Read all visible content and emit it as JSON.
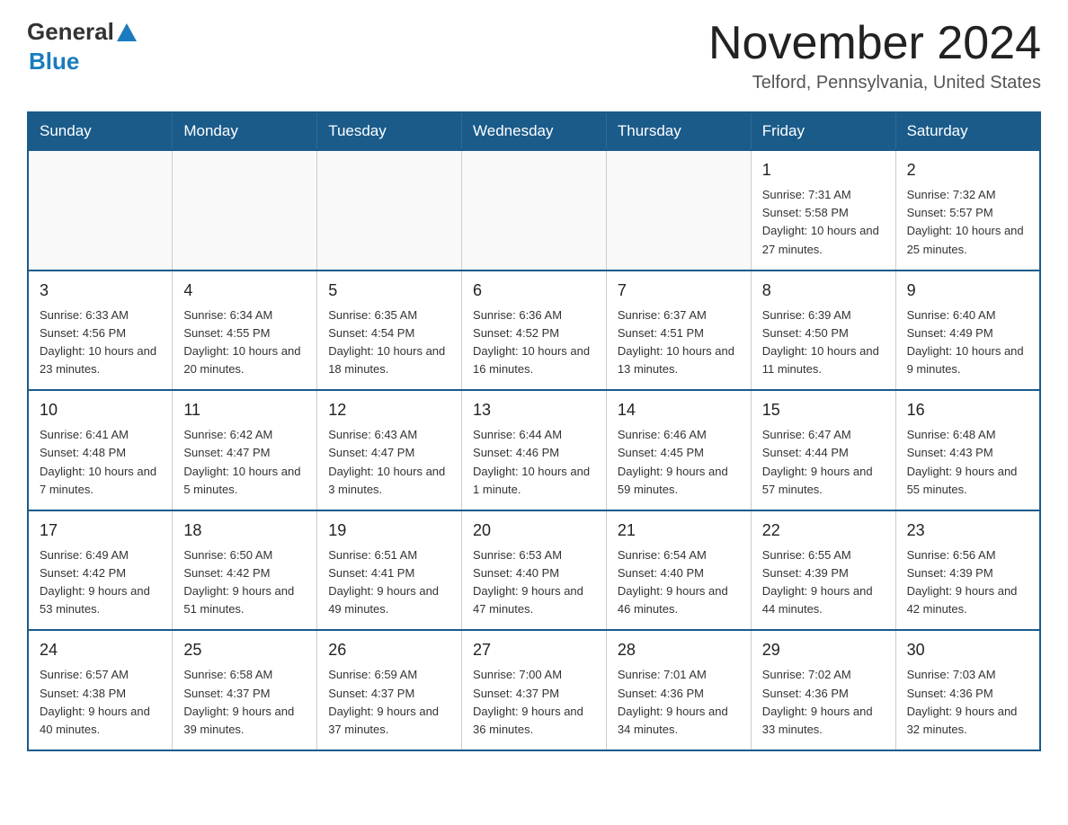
{
  "header": {
    "logo_general": "General",
    "logo_blue": "Blue",
    "month_title": "November 2024",
    "location": "Telford, Pennsylvania, United States"
  },
  "weekdays": [
    "Sunday",
    "Monday",
    "Tuesday",
    "Wednesday",
    "Thursday",
    "Friday",
    "Saturday"
  ],
  "weeks": [
    [
      {
        "day": "",
        "info": ""
      },
      {
        "day": "",
        "info": ""
      },
      {
        "day": "",
        "info": ""
      },
      {
        "day": "",
        "info": ""
      },
      {
        "day": "",
        "info": ""
      },
      {
        "day": "1",
        "info": "Sunrise: 7:31 AM\nSunset: 5:58 PM\nDaylight: 10 hours and 27 minutes."
      },
      {
        "day": "2",
        "info": "Sunrise: 7:32 AM\nSunset: 5:57 PM\nDaylight: 10 hours and 25 minutes."
      }
    ],
    [
      {
        "day": "3",
        "info": "Sunrise: 6:33 AM\nSunset: 4:56 PM\nDaylight: 10 hours and 23 minutes."
      },
      {
        "day": "4",
        "info": "Sunrise: 6:34 AM\nSunset: 4:55 PM\nDaylight: 10 hours and 20 minutes."
      },
      {
        "day": "5",
        "info": "Sunrise: 6:35 AM\nSunset: 4:54 PM\nDaylight: 10 hours and 18 minutes."
      },
      {
        "day": "6",
        "info": "Sunrise: 6:36 AM\nSunset: 4:52 PM\nDaylight: 10 hours and 16 minutes."
      },
      {
        "day": "7",
        "info": "Sunrise: 6:37 AM\nSunset: 4:51 PM\nDaylight: 10 hours and 13 minutes."
      },
      {
        "day": "8",
        "info": "Sunrise: 6:39 AM\nSunset: 4:50 PM\nDaylight: 10 hours and 11 minutes."
      },
      {
        "day": "9",
        "info": "Sunrise: 6:40 AM\nSunset: 4:49 PM\nDaylight: 10 hours and 9 minutes."
      }
    ],
    [
      {
        "day": "10",
        "info": "Sunrise: 6:41 AM\nSunset: 4:48 PM\nDaylight: 10 hours and 7 minutes."
      },
      {
        "day": "11",
        "info": "Sunrise: 6:42 AM\nSunset: 4:47 PM\nDaylight: 10 hours and 5 minutes."
      },
      {
        "day": "12",
        "info": "Sunrise: 6:43 AM\nSunset: 4:47 PM\nDaylight: 10 hours and 3 minutes."
      },
      {
        "day": "13",
        "info": "Sunrise: 6:44 AM\nSunset: 4:46 PM\nDaylight: 10 hours and 1 minute."
      },
      {
        "day": "14",
        "info": "Sunrise: 6:46 AM\nSunset: 4:45 PM\nDaylight: 9 hours and 59 minutes."
      },
      {
        "day": "15",
        "info": "Sunrise: 6:47 AM\nSunset: 4:44 PM\nDaylight: 9 hours and 57 minutes."
      },
      {
        "day": "16",
        "info": "Sunrise: 6:48 AM\nSunset: 4:43 PM\nDaylight: 9 hours and 55 minutes."
      }
    ],
    [
      {
        "day": "17",
        "info": "Sunrise: 6:49 AM\nSunset: 4:42 PM\nDaylight: 9 hours and 53 minutes."
      },
      {
        "day": "18",
        "info": "Sunrise: 6:50 AM\nSunset: 4:42 PM\nDaylight: 9 hours and 51 minutes."
      },
      {
        "day": "19",
        "info": "Sunrise: 6:51 AM\nSunset: 4:41 PM\nDaylight: 9 hours and 49 minutes."
      },
      {
        "day": "20",
        "info": "Sunrise: 6:53 AM\nSunset: 4:40 PM\nDaylight: 9 hours and 47 minutes."
      },
      {
        "day": "21",
        "info": "Sunrise: 6:54 AM\nSunset: 4:40 PM\nDaylight: 9 hours and 46 minutes."
      },
      {
        "day": "22",
        "info": "Sunrise: 6:55 AM\nSunset: 4:39 PM\nDaylight: 9 hours and 44 minutes."
      },
      {
        "day": "23",
        "info": "Sunrise: 6:56 AM\nSunset: 4:39 PM\nDaylight: 9 hours and 42 minutes."
      }
    ],
    [
      {
        "day": "24",
        "info": "Sunrise: 6:57 AM\nSunset: 4:38 PM\nDaylight: 9 hours and 40 minutes."
      },
      {
        "day": "25",
        "info": "Sunrise: 6:58 AM\nSunset: 4:37 PM\nDaylight: 9 hours and 39 minutes."
      },
      {
        "day": "26",
        "info": "Sunrise: 6:59 AM\nSunset: 4:37 PM\nDaylight: 9 hours and 37 minutes."
      },
      {
        "day": "27",
        "info": "Sunrise: 7:00 AM\nSunset: 4:37 PM\nDaylight: 9 hours and 36 minutes."
      },
      {
        "day": "28",
        "info": "Sunrise: 7:01 AM\nSunset: 4:36 PM\nDaylight: 9 hours and 34 minutes."
      },
      {
        "day": "29",
        "info": "Sunrise: 7:02 AM\nSunset: 4:36 PM\nDaylight: 9 hours and 33 minutes."
      },
      {
        "day": "30",
        "info": "Sunrise: 7:03 AM\nSunset: 4:36 PM\nDaylight: 9 hours and 32 minutes."
      }
    ]
  ]
}
